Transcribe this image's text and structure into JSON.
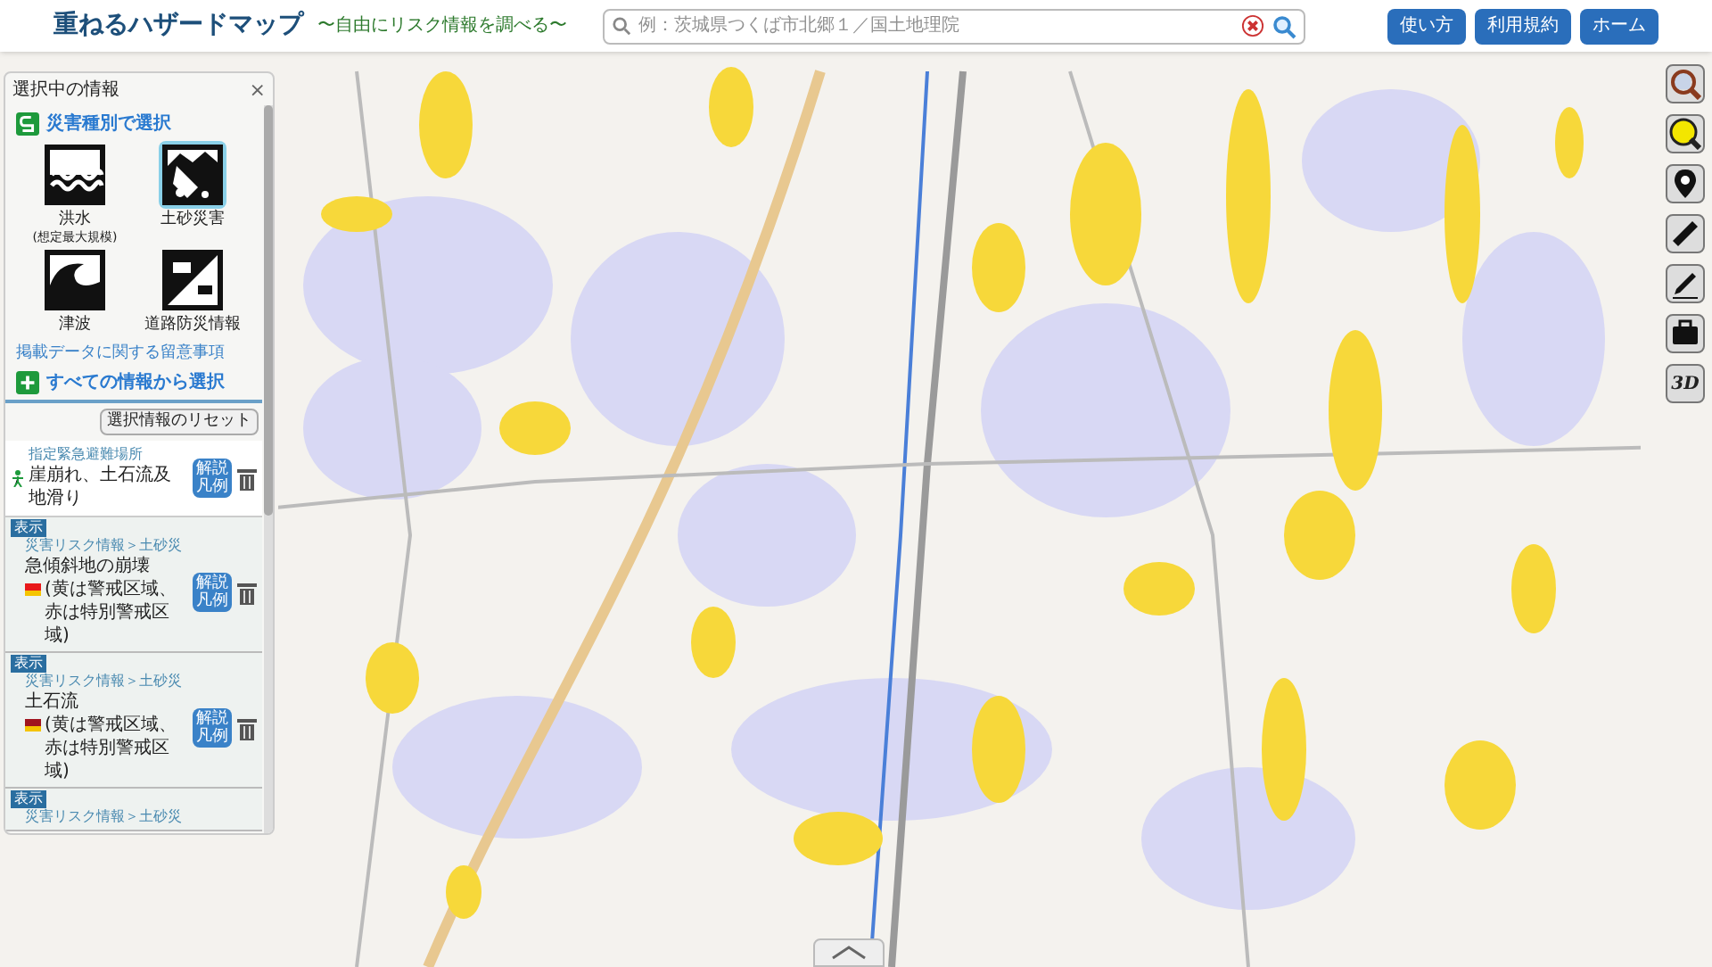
{
  "header": {
    "title": "重ねるハザードマップ",
    "subtitle": "〜自由にリスク情報を調べる〜",
    "search": {
      "placeholder": "例：茨城県つくば市北郷１／国土地理院"
    },
    "buttons": [
      "使い方",
      "利用規約",
      "ホーム"
    ]
  },
  "panel": {
    "title": "選択中の情報",
    "close": "×",
    "hazard_section": "災害種別で選択",
    "hazards": [
      {
        "kind": "flood",
        "label": "洪水",
        "note": "(想定最大規模)",
        "selected": false
      },
      {
        "kind": "landslide",
        "label": "土砂災害",
        "selected": true
      },
      {
        "kind": "tsunami",
        "label": "津波",
        "selected": false
      },
      {
        "kind": "road",
        "label": "道路防災情報",
        "selected": false
      }
    ],
    "notice_link": "掲載データに関する留意事項",
    "all_section": "すべての情報から選択",
    "reset_button": "選択情報のリセット",
    "layers": [
      {
        "kind": "shelter",
        "category": "指定緊急避難場所",
        "name": "崖崩れ、土石流及",
        "name_2": "地滑り",
        "legend_button": "解説凡例"
      },
      {
        "kind": "risk",
        "badge": "表示",
        "category": "災害リスク情報＞土砂災",
        "name": "急傾斜地の崩壊",
        "note": "(黄は警戒区域、赤は特別警戒区域)",
        "color": "#e8191a",
        "legend_button": "解説凡例"
      },
      {
        "kind": "risk",
        "badge": "表示",
        "category": "災害リスク情報＞土砂災",
        "name": "土石流",
        "note": "(黄は警戒区域、赤は特別警戒区域)",
        "color": "#a0141e",
        "legend_button": "解説凡例"
      },
      {
        "kind": "partial",
        "badge": "表示",
        "category": "災害リスク情報＞土砂災"
      }
    ]
  },
  "toolbar": {
    "three_d": "3D"
  }
}
